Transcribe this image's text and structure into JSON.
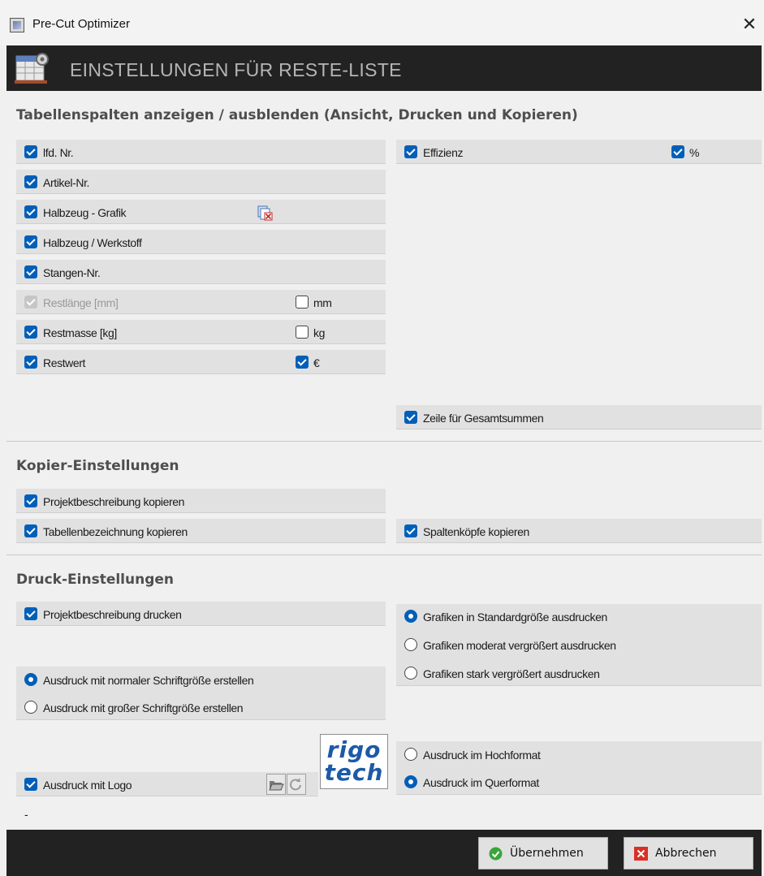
{
  "window": {
    "title": "Pre-Cut Optimizer",
    "close_glyph": "✕"
  },
  "header": {
    "title": "EINSTELLUNGEN FÜR RESTE-LISTE",
    "icon": "table-settings-icon"
  },
  "columns_section": {
    "title": "Tabellenspalten anzeigen / ausblenden (Ansicht, Drucken und Kopieren)",
    "left": [
      {
        "label": "lfd. Nr.",
        "checked": true
      },
      {
        "label": "Artikel-Nr.",
        "checked": true
      },
      {
        "label": "Halbzeug - Grafik",
        "checked": true
      },
      {
        "label": "Halbzeug / Werkstoff",
        "checked": true
      },
      {
        "label": "Stangen-Nr.",
        "checked": true
      },
      {
        "label": "Restlänge [mm]",
        "checked": true,
        "disabled": true,
        "unit_label": "mm",
        "unit_checked": false
      },
      {
        "label": "Restmasse [kg]",
        "checked": true,
        "unit_label": "kg",
        "unit_checked": false
      },
      {
        "label": "Restwert",
        "checked": true,
        "unit_label": "€",
        "unit_checked": true
      }
    ],
    "right": [
      {
        "label": "Effizienz",
        "checked": true,
        "unit_label": "%",
        "unit_checked": true
      }
    ],
    "totals": {
      "label": "Zeile für Gesamtsummen",
      "checked": true
    }
  },
  "copy_section": {
    "title": "Kopier-Einstellungen",
    "project_desc": "Projektbeschreibung kopieren",
    "table_name": "Tabellenbezeichnung kopieren",
    "column_heads": "Spaltenköpfe kopieren"
  },
  "print_section": {
    "title": "Druck-Einstellungen",
    "project_desc": "Projektbeschreibung drucken",
    "graphics_options": [
      {
        "label": "Grafiken in Standardgröße ausdrucken",
        "selected": true
      },
      {
        "label": "Grafiken moderat vergrößert ausdrucken",
        "selected": false
      },
      {
        "label": "Grafiken stark vergrößert ausdrucken",
        "selected": false
      }
    ],
    "font_options": [
      {
        "label": "Ausdruck mit normaler Schriftgröße erstellen",
        "selected": true
      },
      {
        "label": "Ausdruck mit großer Schriftgröße erstellen",
        "selected": false
      }
    ],
    "orientation_options": [
      {
        "label": "Ausdruck im Hochformat",
        "selected": false
      },
      {
        "label": "Ausdruck im Querformat",
        "selected": true
      }
    ],
    "logo": {
      "label": "Ausdruck mit Logo",
      "checked": true,
      "logo_line1": "rigo",
      "logo_line2": "tech"
    },
    "logo_path": "-"
  },
  "buttons": {
    "apply": "Übernehmen",
    "cancel": "Abbrechen"
  },
  "colors": {
    "accent": "#005fb8",
    "header_bg": "#222222",
    "row_bg": "#e1e1e1"
  }
}
